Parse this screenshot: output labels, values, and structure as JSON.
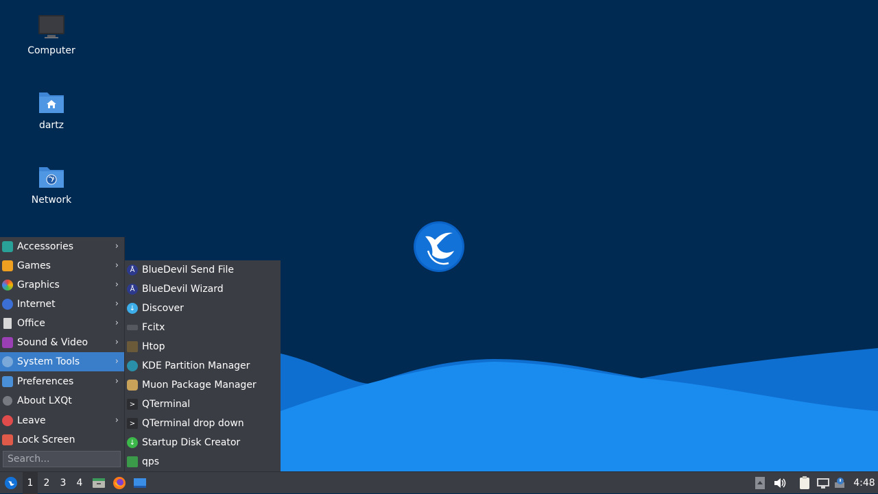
{
  "desktop": {
    "icons": [
      {
        "label": "Computer"
      },
      {
        "label": "dartz"
      },
      {
        "label": "Network"
      }
    ]
  },
  "menu": {
    "items": [
      {
        "label": "Accessories",
        "has_submenu": true
      },
      {
        "label": "Games",
        "has_submenu": true
      },
      {
        "label": "Graphics",
        "has_submenu": true
      },
      {
        "label": "Internet",
        "has_submenu": true
      },
      {
        "label": "Office",
        "has_submenu": true
      },
      {
        "label": "Sound & Video",
        "has_submenu": true
      },
      {
        "label": "System Tools",
        "has_submenu": true,
        "active": true
      },
      {
        "label": "Preferences",
        "has_submenu": true
      },
      {
        "label": "About LXQt",
        "has_submenu": false
      },
      {
        "label": "Leave",
        "has_submenu": true
      },
      {
        "label": "Lock Screen",
        "has_submenu": false
      }
    ],
    "search_placeholder": "Search..."
  },
  "submenu": {
    "items": [
      {
        "label": "BlueDevil Send File"
      },
      {
        "label": "BlueDevil Wizard"
      },
      {
        "label": "Discover"
      },
      {
        "label": "Fcitx"
      },
      {
        "label": "Htop"
      },
      {
        "label": "KDE Partition Manager"
      },
      {
        "label": "Muon Package Manager"
      },
      {
        "label": "QTerminal"
      },
      {
        "label": "QTerminal drop down"
      },
      {
        "label": "Startup Disk Creator"
      },
      {
        "label": "qps"
      }
    ]
  },
  "taskbar": {
    "workspaces": [
      "1",
      "2",
      "3",
      "4"
    ],
    "active_workspace": "1",
    "clock": "4:48"
  },
  "colors": {
    "desktop_bg": "#002a52",
    "wave_light": "#1a8cf0",
    "menu_bg": "#3b3d44",
    "highlight": "#3a7dc9"
  }
}
